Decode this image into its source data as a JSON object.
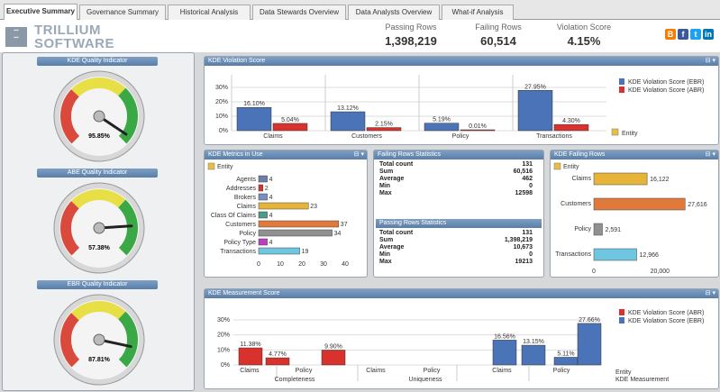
{
  "tabs": [
    "Executive Summary",
    "Governance Summary",
    "Historical Analysis",
    "Data Stewards Overview",
    "Data Analysts Overview",
    "What-if Analysis"
  ],
  "header": {
    "brand_line1": "TRILLIUM",
    "brand_line2": "SOFTWARE",
    "stats": [
      {
        "label": "Passing Rows",
        "value": "1,398,219"
      },
      {
        "label": "Failing Rows",
        "value": "60,514"
      },
      {
        "label": "Violation Score",
        "value": "4.15%"
      }
    ],
    "social_icons": [
      "blogger-icon",
      "facebook-icon",
      "twitter-icon",
      "linkedin-icon"
    ]
  },
  "gauges": [
    {
      "title": "KDE Quality Indicator",
      "value": "95.85%",
      "level": 0.9585
    },
    {
      "title": "ABE Quality Indicator",
      "value": "57.38%",
      "level": 0.82
    },
    {
      "title": "EBR Quality Indicator",
      "value": "87.81%",
      "level": 0.8781
    }
  ],
  "violation": {
    "title": "KDE Violation Score",
    "legend": [
      "KDE Violation Score (EBR)",
      "KDE Violation Score (ABR)"
    ],
    "entity_label": "Entity",
    "yticks": [
      "30%",
      "20%",
      "10%",
      "0%"
    ],
    "colors": {
      "ebr": "#4b73b8",
      "abr": "#d9322c"
    }
  },
  "metrics": {
    "title": "KDE Metrics in Use",
    "entity_label": "Entity",
    "xticks": [
      "0",
      "10",
      "20",
      "30",
      "40"
    ]
  },
  "failing_stats": {
    "title": "Failing Rows Statistics",
    "rows": [
      {
        "k": "Total count",
        "v": "131"
      },
      {
        "k": "Sum",
        "v": "60,516"
      },
      {
        "k": "Average",
        "v": "462"
      },
      {
        "k": "Min",
        "v": "0"
      },
      {
        "k": "Max",
        "v": "12598"
      }
    ]
  },
  "passing_stats": {
    "title": "Passing Rows Statistics",
    "rows": [
      {
        "k": "Total count",
        "v": "131"
      },
      {
        "k": "Sum",
        "v": "1,398,219"
      },
      {
        "k": "Average",
        "v": "10,673"
      },
      {
        "k": "Min",
        "v": "0"
      },
      {
        "k": "Max",
        "v": "19213"
      }
    ]
  },
  "failing_rows": {
    "title": "KDE Failing Rows",
    "entity_label": "Entity",
    "xticks": [
      "0",
      "20,000"
    ]
  },
  "measurement": {
    "title": "KDE Measurement Score",
    "legend": [
      "KDE Violation Score (ABR)",
      "KDE Violation Score (EBR)"
    ],
    "yticks": [
      "30%",
      "20%",
      "10%",
      "0%"
    ],
    "group_labels": [
      "Completeness",
      "Uniqueness"
    ],
    "axis_labels": [
      "Entity",
      "KDE Measurement"
    ]
  },
  "chart_data": [
    {
      "type": "bar",
      "title": "KDE Violation Score",
      "categories": [
        "Claims",
        "Customers",
        "Policy",
        "Transactions"
      ],
      "series": [
        {
          "name": "KDE Violation Score (EBR)",
          "values": [
            16.1,
            13.12,
            5.19,
            27.95
          ],
          "labels": [
            "16.10%",
            "13.12%",
            "5.19%",
            "27.95%"
          ]
        },
        {
          "name": "KDE Violation Score (ABR)",
          "values": [
            5.04,
            2.15,
            0.01,
            4.3
          ],
          "labels": [
            "5.04%",
            "2.15%",
            "0.01%",
            "4.30%"
          ]
        }
      ],
      "ylim": [
        0,
        30
      ],
      "xlabel": "Entity"
    },
    {
      "type": "bar",
      "orientation": "horizontal",
      "title": "KDE Metrics in Use",
      "categories": [
        "Agents",
        "Addresses",
        "Brokers",
        "Claims",
        "Class Of Claims",
        "Customers",
        "Policy",
        "Policy Type",
        "Transactions"
      ],
      "values": [
        4,
        2,
        4,
        23,
        4,
        37,
        34,
        4,
        19
      ],
      "colors": [
        "#6d7fa8",
        "#d9322c",
        "#7a8fc0",
        "#e7b43a",
        "#4b9a8a",
        "#e07a3c",
        "#909090",
        "#c03cc0",
        "#6ec6e0"
      ],
      "xlim": [
        0,
        40
      ]
    },
    {
      "type": "bar",
      "orientation": "horizontal",
      "title": "KDE Failing Rows",
      "categories": [
        "Claims",
        "Customers",
        "Policy",
        "Transactions"
      ],
      "values": [
        16122,
        27616,
        2591,
        12966
      ],
      "labels": [
        "16,122",
        "27,616",
        "2,591",
        "12,966"
      ],
      "colors": [
        "#e7b43a",
        "#e07a3c",
        "#909090",
        "#6ec6e0"
      ],
      "xlim": [
        0,
        30000
      ]
    },
    {
      "type": "bar",
      "title": "KDE Measurement Score",
      "categories": [
        "Claims",
        "Policy",
        "Claims",
        "Policy",
        "Claims",
        "Policy"
      ],
      "groups": [
        "Completeness",
        "Completeness",
        "Uniqueness",
        "Uniqueness",
        "Uniqueness",
        "Uniqueness"
      ],
      "bars": [
        {
          "label": "11.38%",
          "value": 11.38,
          "series": "ABR"
        },
        {
          "label": "4.77%",
          "value": 4.77,
          "series": "ABR"
        },
        {
          "label": "9.90%",
          "value": 9.9,
          "series": "ABR"
        },
        {
          "label": "16.56%",
          "value": 16.56,
          "series": "EBR"
        },
        {
          "label": "13.15%",
          "value": 13.15,
          "series": "EBR"
        },
        {
          "label": "5.11%",
          "value": 5.11,
          "series": "EBR"
        },
        {
          "label": "27.66%",
          "value": 27.66,
          "series": "EBR"
        }
      ],
      "ylim": [
        0,
        30
      ]
    }
  ]
}
